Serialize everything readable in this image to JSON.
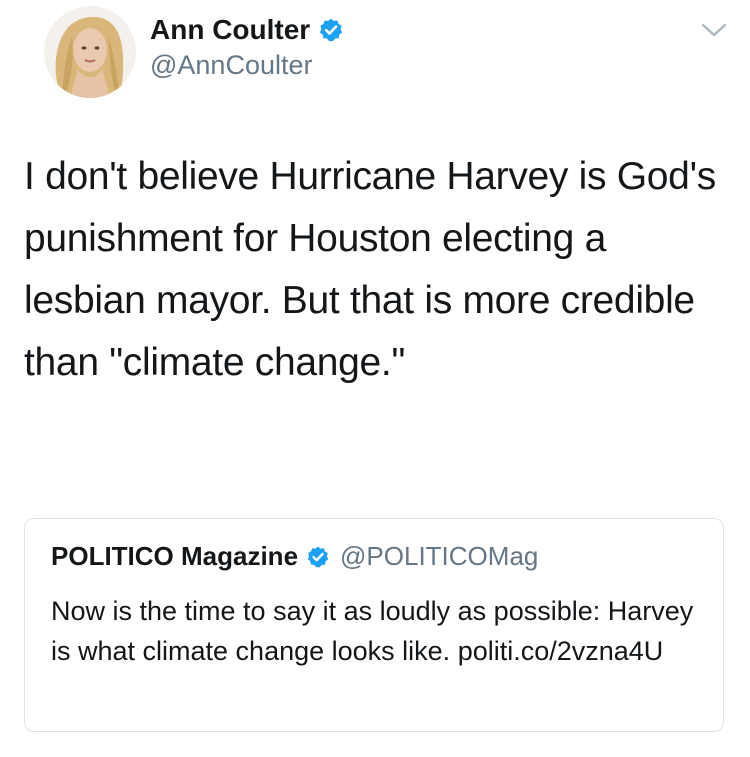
{
  "author": {
    "display_name": "Ann Coulter",
    "handle": "@AnnCoulter",
    "verified": true,
    "avatar": "profile-photo"
  },
  "tweet": {
    "text": "I don't believe Hurricane Harvey is God's punishment for Houston electing a lesbian mayor. But that is more credible than \"climate change.\""
  },
  "quoted_tweet": {
    "display_name": "POLITICO Magazine",
    "handle": "@POLITICOMag",
    "verified": true,
    "text": "Now is the time to say it as loudly as possible: Harvey is what climate change looks like. politi.co/2vzna4U"
  },
  "icons": {
    "verified": "verified-badge-icon",
    "menu": "chevron-down-icon"
  },
  "colors": {
    "verified_blue": "#1da1f2",
    "text_primary": "#14171a",
    "text_secondary": "#657786",
    "border": "#dfe3e8"
  }
}
